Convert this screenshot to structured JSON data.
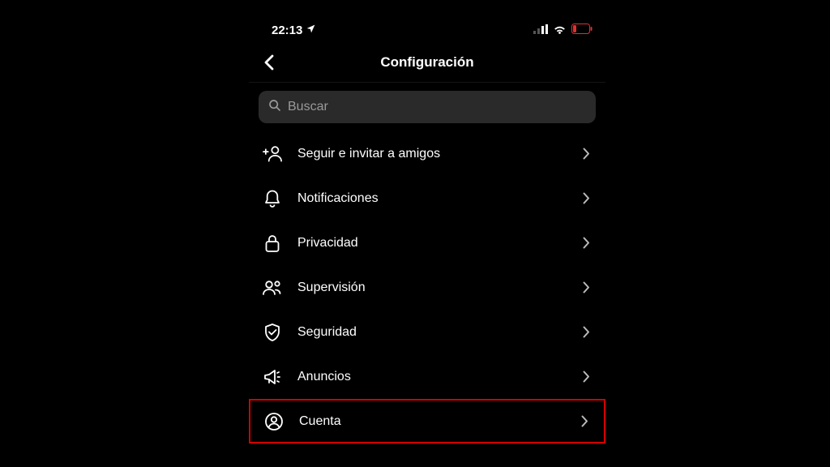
{
  "status": {
    "time": "22:13"
  },
  "header": {
    "title": "Configuración"
  },
  "search": {
    "placeholder": "Buscar"
  },
  "menu": {
    "items": [
      {
        "label": "Seguir e invitar a amigos",
        "icon": "person-plus-icon",
        "highlight": false
      },
      {
        "label": "Notificaciones",
        "icon": "bell-icon",
        "highlight": false
      },
      {
        "label": "Privacidad",
        "icon": "lock-icon",
        "highlight": false
      },
      {
        "label": "Supervisión",
        "icon": "people-icon",
        "highlight": false
      },
      {
        "label": "Seguridad",
        "icon": "shield-icon",
        "highlight": false
      },
      {
        "label": "Anuncios",
        "icon": "megaphone-icon",
        "highlight": false
      },
      {
        "label": "Cuenta",
        "icon": "account-icon",
        "highlight": true
      }
    ]
  }
}
